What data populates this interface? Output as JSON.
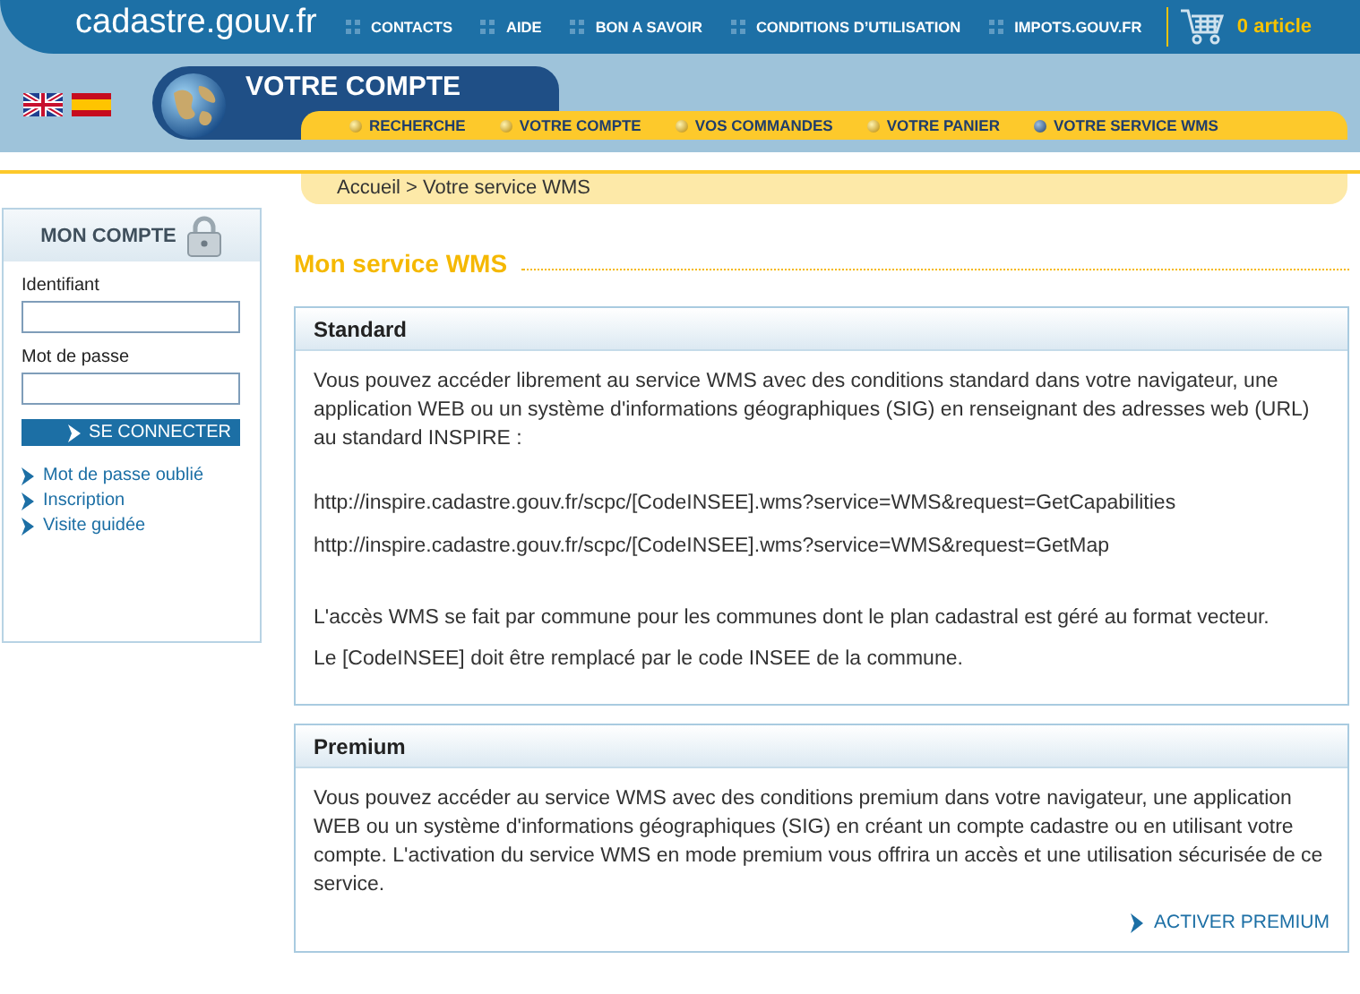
{
  "logo": "cadastre.gouv.fr",
  "top_menu": [
    "CONTACTS",
    "AIDE",
    "BON A SAVOIR",
    "CONDITIONS D’UTILISATION",
    "IMPOTS.GOUV.FR"
  ],
  "cart": "0 article",
  "section_title": "VOTRE COMPTE",
  "nav": [
    {
      "label": "RECHERCHE",
      "selected": false
    },
    {
      "label": "VOTRE COMPTE",
      "selected": false
    },
    {
      "label": "VOS COMMANDES",
      "selected": false
    },
    {
      "label": "VOTRE PANIER",
      "selected": false
    },
    {
      "label": "VOTRE SERVICE WMS",
      "selected": true
    }
  ],
  "breadcrumb": "Accueil > Votre service WMS",
  "login": {
    "title": "MON COMPTE",
    "fields": [
      {
        "label": "Identifiant"
      },
      {
        "label": "Mot de passe"
      }
    ],
    "button": "SE CONNECTER",
    "links": [
      "Mot de passe oublié",
      "Inscription",
      "Visite guidée"
    ]
  },
  "page_title": "Mon service WMS",
  "panels": [
    {
      "title": "Standard",
      "blocks": [
        {
          "kind": "text",
          "text": "Vous pouvez accéder librement au service WMS avec des conditions standard dans votre navigateur, une application WEB ou un système d'informations géographiques (SIG) en renseignant des adresses web (URL) au standard INSPIRE :"
        },
        {
          "kind": "urls",
          "lines": [
            "http://inspire.cadastre.gouv.fr/scpc/[CodeINSEE].wms?service=WMS&request=GetCapabilities",
            "http://inspire.cadastre.gouv.fr/scpc/[CodeINSEE].wms?service=WMS&request=GetMap"
          ]
        },
        {
          "kind": "text",
          "text": "L'accès WMS se fait par commune pour les communes dont le plan cadastral est géré au format vecteur."
        },
        {
          "kind": "text",
          "text": "Le [CodeINSEE] doit être remplacé par le code INSEE de la commune."
        }
      ]
    },
    {
      "title": "Premium",
      "blocks": [
        {
          "kind": "text",
          "text": "Vous pouvez accéder au service WMS avec des conditions premium dans votre navigateur, une application WEB ou un système d'informations géographiques (SIG) en créant un compte cadastre ou en utilisant votre compte. L'activation du service WMS en mode premium vous offrira un accès et une utilisation sécurisée de ce service."
        }
      ],
      "action": "ACTIVER PREMIUM"
    }
  ]
}
